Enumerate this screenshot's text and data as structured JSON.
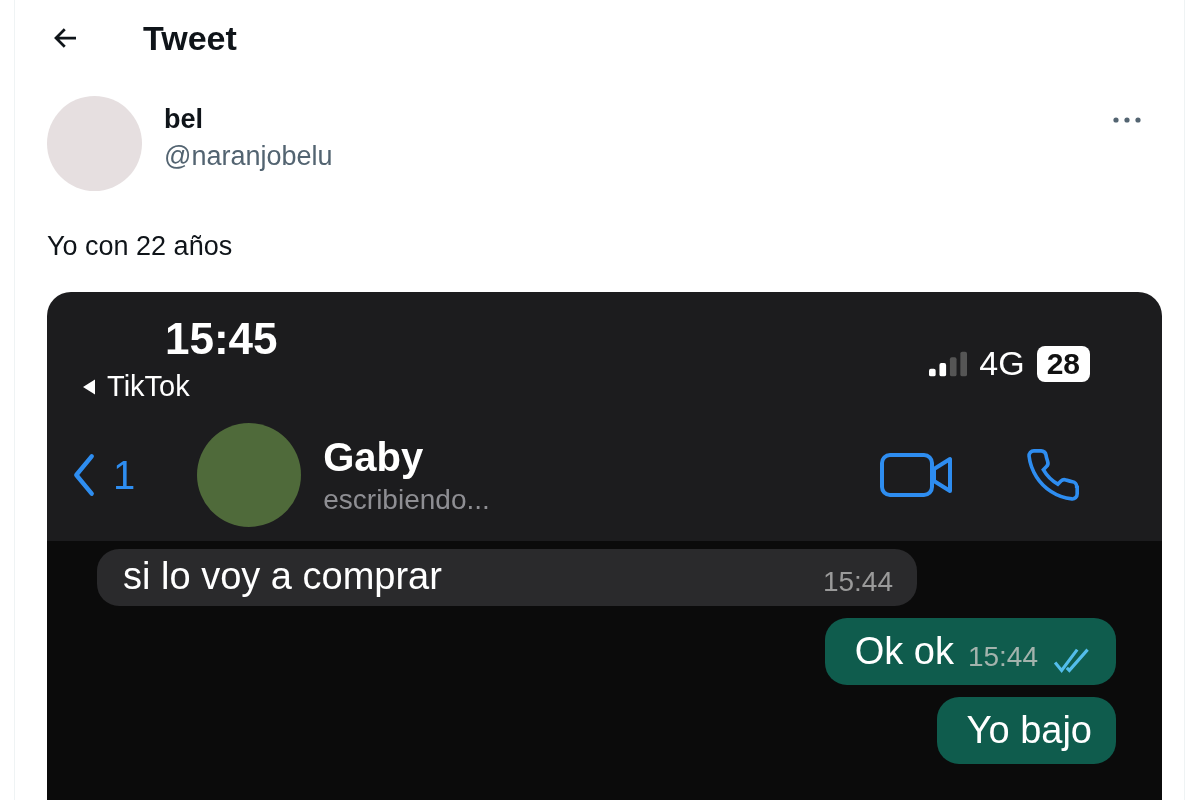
{
  "header": {
    "title": "Tweet"
  },
  "author": {
    "name": "bel",
    "handle": "@naranjobelu"
  },
  "text": "Yo con 22 años",
  "media": {
    "status_bar": {
      "time": "15:45",
      "back_app": "TikTok",
      "network": "4G",
      "battery": "28"
    },
    "chat_header": {
      "unread": "1",
      "contact": "Gaby",
      "status": "escribiendo..."
    },
    "messages": [
      {
        "kind": "incoming",
        "text": "si lo voy a comprar",
        "time": "15:44"
      },
      {
        "kind": "outgoing",
        "text": "Ok ok",
        "time": "15:44",
        "read": true
      },
      {
        "kind": "outgoing",
        "text": "Yo bajo"
      }
    ]
  }
}
